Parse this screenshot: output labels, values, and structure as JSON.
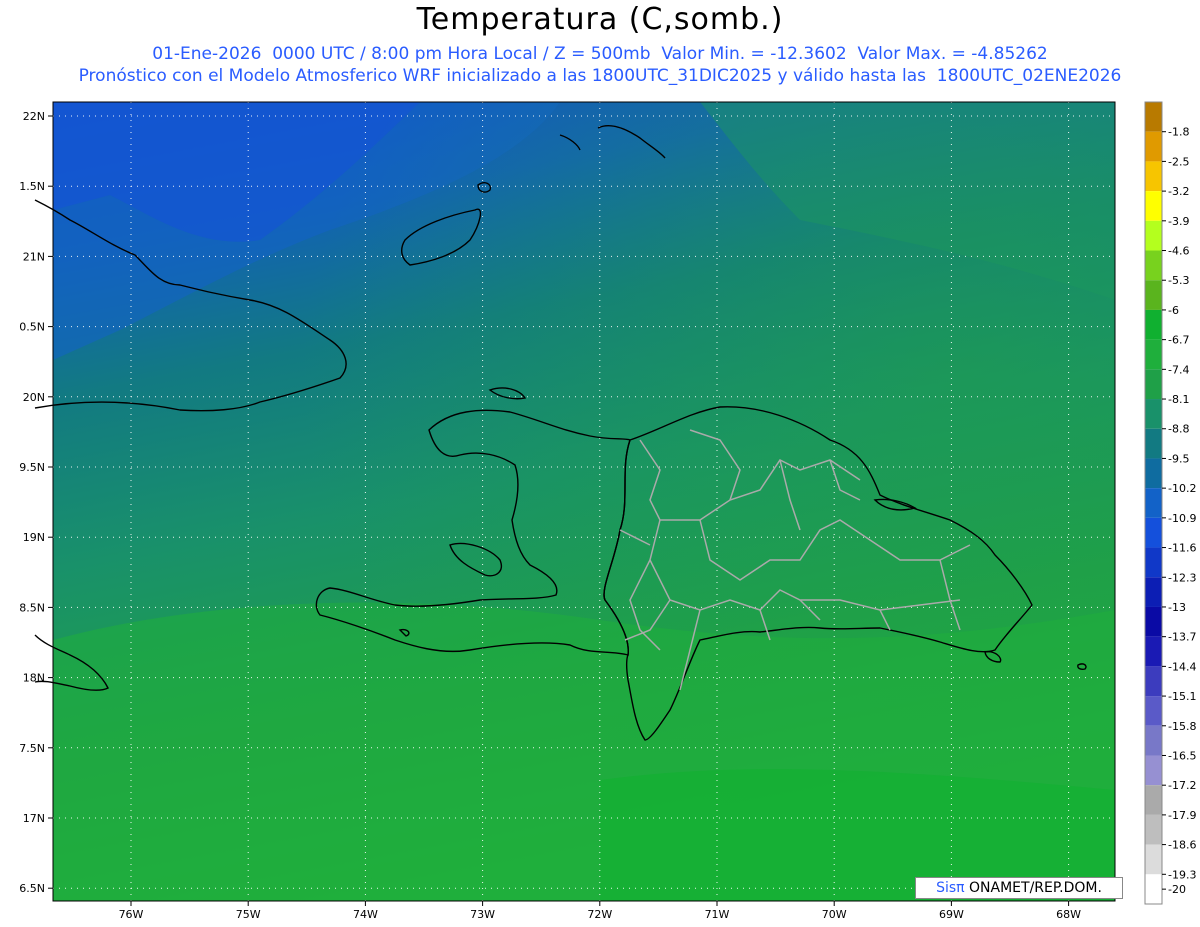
{
  "title": "Temperatura (C,somb.)",
  "subtitle_1": "01-Ene-2026  0000 UTC / 8:00 pm Hora Local / Z = 500mb  Valor Min. = -12.3602  Valor Max. = -4.85262",
  "subtitle_2": "Pronóstico con el Modelo Atmosferico WRF inicializado a las 1800UTC_31DIC2025 y válido hasta las  1800UTC_02ENE2026",
  "credit": {
    "brand": "Sisπ",
    "text": " ONAMET/REP.DOM."
  },
  "lat_labels": [
    "22N",
    "1.5N",
    "21N",
    "0.5N",
    "20N",
    "9.5N",
    "19N",
    "8.5N",
    "18N",
    "7.5N",
    "17N",
    "6.5N"
  ],
  "lon_labels": [
    "76W",
    "75W",
    "74W",
    "73W",
    "72W",
    "71W",
    "70W",
    "69W",
    "68W"
  ],
  "colorbar": {
    "labels": [
      "-1.8",
      "-2.5",
      "-3.2",
      "-3.9",
      "-4.6",
      "-5.3",
      "-6",
      "-6.7",
      "-7.4",
      "-8.1",
      "-8.8",
      "-9.5",
      "-10.2",
      "-10.9",
      "-11.6",
      "-12.3",
      "-13",
      "-13.7",
      "-14.4",
      "-15.1",
      "-15.8",
      "-16.5",
      "-17.2",
      "-17.9",
      "-18.6",
      "-19.3",
      "-20"
    ],
    "colors": [
      "#b87a00",
      "#e09a00",
      "#f7c500",
      "#ffff00",
      "#b4ff1e",
      "#78d21e",
      "#5ab41e",
      "#10b030",
      "#1faf3c",
      "#1fa048",
      "#19916a",
      "#127a82",
      "#0f6ca0",
      "#1262c8",
      "#1450dc",
      "#1038c8",
      "#0c1eb4",
      "#0a0aa5",
      "#1a1ab4",
      "#3c3cbe",
      "#5a5ac8",
      "#7878c8",
      "#9690d2",
      "#aaaaaa",
      "#bebebe",
      "#dcdcdc",
      "#ffffff"
    ]
  }
}
